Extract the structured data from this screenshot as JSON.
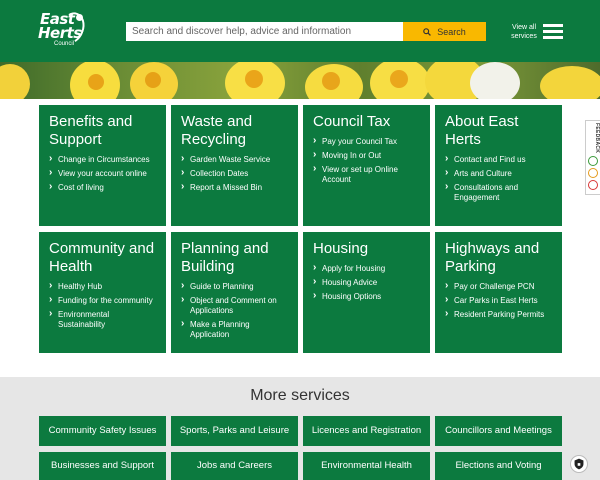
{
  "header": {
    "logo": {
      "line1": "East",
      "line2": "Herts",
      "line3": "Council"
    },
    "search_placeholder": "Search and discover help, advice and information",
    "search_button": "Search",
    "view_all": "View all services"
  },
  "feedback": {
    "label": "FEEDBACK"
  },
  "tiles": [
    {
      "title": "Benefits and Support",
      "links": [
        "Change in Circumstances",
        "View your account online",
        "Cost of living"
      ]
    },
    {
      "title": "Waste and Recycling",
      "links": [
        "Garden Waste Service",
        "Collection Dates",
        "Report a Missed Bin"
      ]
    },
    {
      "title": "Council Tax",
      "links": [
        "Pay your Council Tax",
        "Moving In or Out",
        "View or set up Online Account"
      ]
    },
    {
      "title": "About East Herts",
      "links": [
        "Contact and Find us",
        "Arts and Culture",
        "Consultations and Engagement"
      ]
    },
    {
      "title": "Community and Health",
      "links": [
        "Healthy Hub",
        "Funding for the community",
        "Environmental Sustainability"
      ]
    },
    {
      "title": "Planning and Building",
      "links": [
        "Guide to Planning",
        "Object and Comment on Applications",
        "Make a Planning Application"
      ]
    },
    {
      "title": "Housing",
      "links": [
        "Apply for Housing",
        "Housing Advice",
        "Housing Options"
      ]
    },
    {
      "title": "Highways and Parking",
      "links": [
        "Pay or Challenge PCN",
        "Car Parks in East Herts",
        "Resident Parking Permits"
      ]
    }
  ],
  "more_services": {
    "heading": "More services",
    "items": [
      "Community Safety Issues",
      "Sports, Parks and Leisure",
      "Licences and Registration",
      "Councillors and Meetings",
      "Businesses and Support",
      "Jobs and Careers",
      "Environmental Health",
      "Elections and Voting"
    ]
  },
  "colors": {
    "brand_green": "#0c7a3f",
    "search_yellow": "#f9b800",
    "more_bg": "#e6e6e6"
  }
}
